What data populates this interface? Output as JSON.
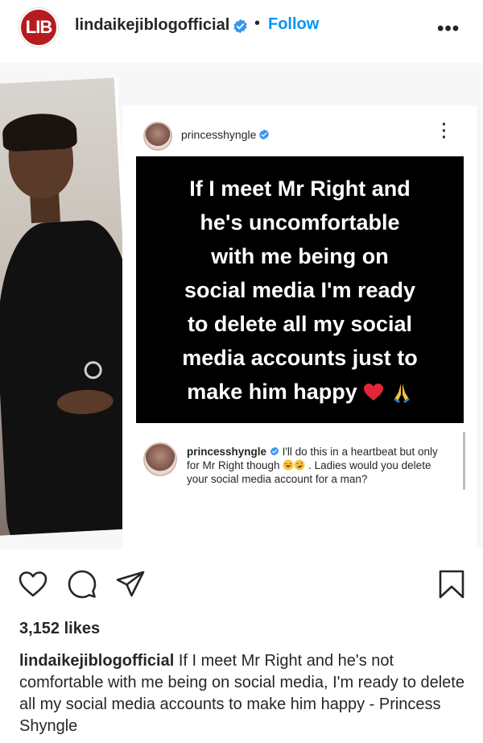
{
  "header": {
    "avatar_text": "LIB",
    "username": "lindaikejiblogofficial",
    "separator": "•",
    "follow_label": "Follow",
    "more_label": "•••"
  },
  "post_image": {
    "screenshot": {
      "username": "princesshyngle",
      "quote_lines": [
        "If I meet Mr Right and",
        "he's uncomfortable",
        "with me being on",
        "social media I'm ready",
        "to delete all my social",
        "media accounts just to",
        "make him happy"
      ],
      "comment_user": "princesshyngle",
      "comment_text_1": "I'll do this in a heartbeat but only for Mr Right though",
      "comment_text_2": ". Ladies would you delete your social media account for a man?"
    }
  },
  "actions": {
    "like_icon": "heart-outline-icon",
    "comment_icon": "speech-bubble-icon",
    "share_icon": "paper-plane-icon",
    "save_icon": "bookmark-icon"
  },
  "likes_text": "3,152 likes",
  "caption": {
    "user": "lindaikejiblogofficial",
    "text": "If I meet Mr Right and he's not comfortable with me being on social media, I'm ready to delete all my social media accounts to make him happy - Princess Shyngle"
  },
  "colors": {
    "accent": "#0095f6",
    "brand": "#b51c20"
  }
}
